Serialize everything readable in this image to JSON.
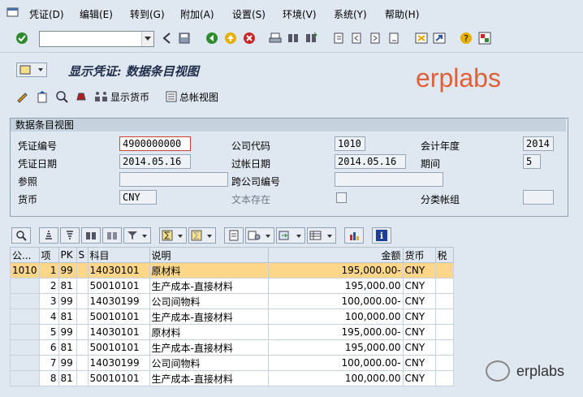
{
  "menu": {
    "items": [
      "凭证(D)",
      "编辑(E)",
      "转到(G)",
      "附加(A)",
      "设置(S)",
      "环境(V)",
      "系统(Y)",
      "帮助(H)"
    ]
  },
  "toolbar": {
    "command_value": "",
    "icons": [
      "check-icon",
      "back-icon",
      "save-icon",
      "nav-back-icon",
      "exit-icon",
      "cancel-icon",
      "print-icon",
      "find-icon",
      "find-next-icon",
      "first-page-icon",
      "prev-page-icon",
      "next-page-icon",
      "last-page-icon",
      "new-session-icon",
      "shortcut-icon",
      "help-icon",
      "layout-icon"
    ]
  },
  "title": {
    "text": "显示凭证: 数据条目视图",
    "watermark": "erplabs"
  },
  "app_toolbar": {
    "display_currency_label": "显示货币",
    "general_ledger_label": "总帐视图"
  },
  "header_group": {
    "title": "数据条目视图",
    "fields": {
      "doc_number_label": "凭证编号",
      "doc_number": "4900000000",
      "company_code_label": "公司代码",
      "company_code": "1010",
      "fiscal_year_label": "会计年度",
      "fiscal_year": "2014",
      "doc_date_label": "凭证日期",
      "doc_date": "2014.05.16",
      "posting_date_label": "过帐日期",
      "posting_date": "2014.05.16",
      "period_label": "期间",
      "period": "5",
      "reference_label": "参照",
      "reference": "",
      "cross_company_label": "跨公司编号",
      "cross_company": "",
      "currency_label": "货币",
      "currency": "CNY",
      "text_exists_label": "文本存在",
      "text_exists": false,
      "ledger_group_label": "分类帐组",
      "ledger_group": ""
    }
  },
  "grid": {
    "columns": [
      "公...",
      "项",
      "PK",
      "S",
      "科目",
      "说明",
      "金额",
      "货币",
      "税"
    ],
    "rows": [
      {
        "company": "1010",
        "item": "1",
        "pk": "99",
        "s": "",
        "account": "14030101",
        "text": "原材料",
        "amount": "195,000.00-",
        "currency": "CNY",
        "tax": ""
      },
      {
        "company": "",
        "item": "2",
        "pk": "81",
        "s": "",
        "account": "50010101",
        "text": "生产成本-直接材料",
        "amount": "195,000.00",
        "currency": "CNY",
        "tax": ""
      },
      {
        "company": "",
        "item": "3",
        "pk": "99",
        "s": "",
        "account": "14030199",
        "text": "公司间物料",
        "amount": "100,000.00-",
        "currency": "CNY",
        "tax": ""
      },
      {
        "company": "",
        "item": "4",
        "pk": "81",
        "s": "",
        "account": "50010101",
        "text": "生产成本-直接材料",
        "amount": "100,000.00",
        "currency": "CNY",
        "tax": ""
      },
      {
        "company": "",
        "item": "5",
        "pk": "99",
        "s": "",
        "account": "14030101",
        "text": "原材料",
        "amount": "195,000.00-",
        "currency": "CNY",
        "tax": ""
      },
      {
        "company": "",
        "item": "6",
        "pk": "81",
        "s": "",
        "account": "50010101",
        "text": "生产成本-直接材料",
        "amount": "195,000.00",
        "currency": "CNY",
        "tax": ""
      },
      {
        "company": "",
        "item": "7",
        "pk": "99",
        "s": "",
        "account": "14030199",
        "text": "公司间物料",
        "amount": "100,000.00-",
        "currency": "CNY",
        "tax": ""
      },
      {
        "company": "",
        "item": "8",
        "pk": "81",
        "s": "",
        "account": "50010101",
        "text": "生产成本-直接材料",
        "amount": "100,000.00",
        "currency": "CNY",
        "tax": ""
      }
    ]
  },
  "footer_watermark": "erplabs",
  "colors": {
    "selected_row": "#fdd68a",
    "watermark": "#e0603a",
    "background": "#dfe7f0"
  }
}
